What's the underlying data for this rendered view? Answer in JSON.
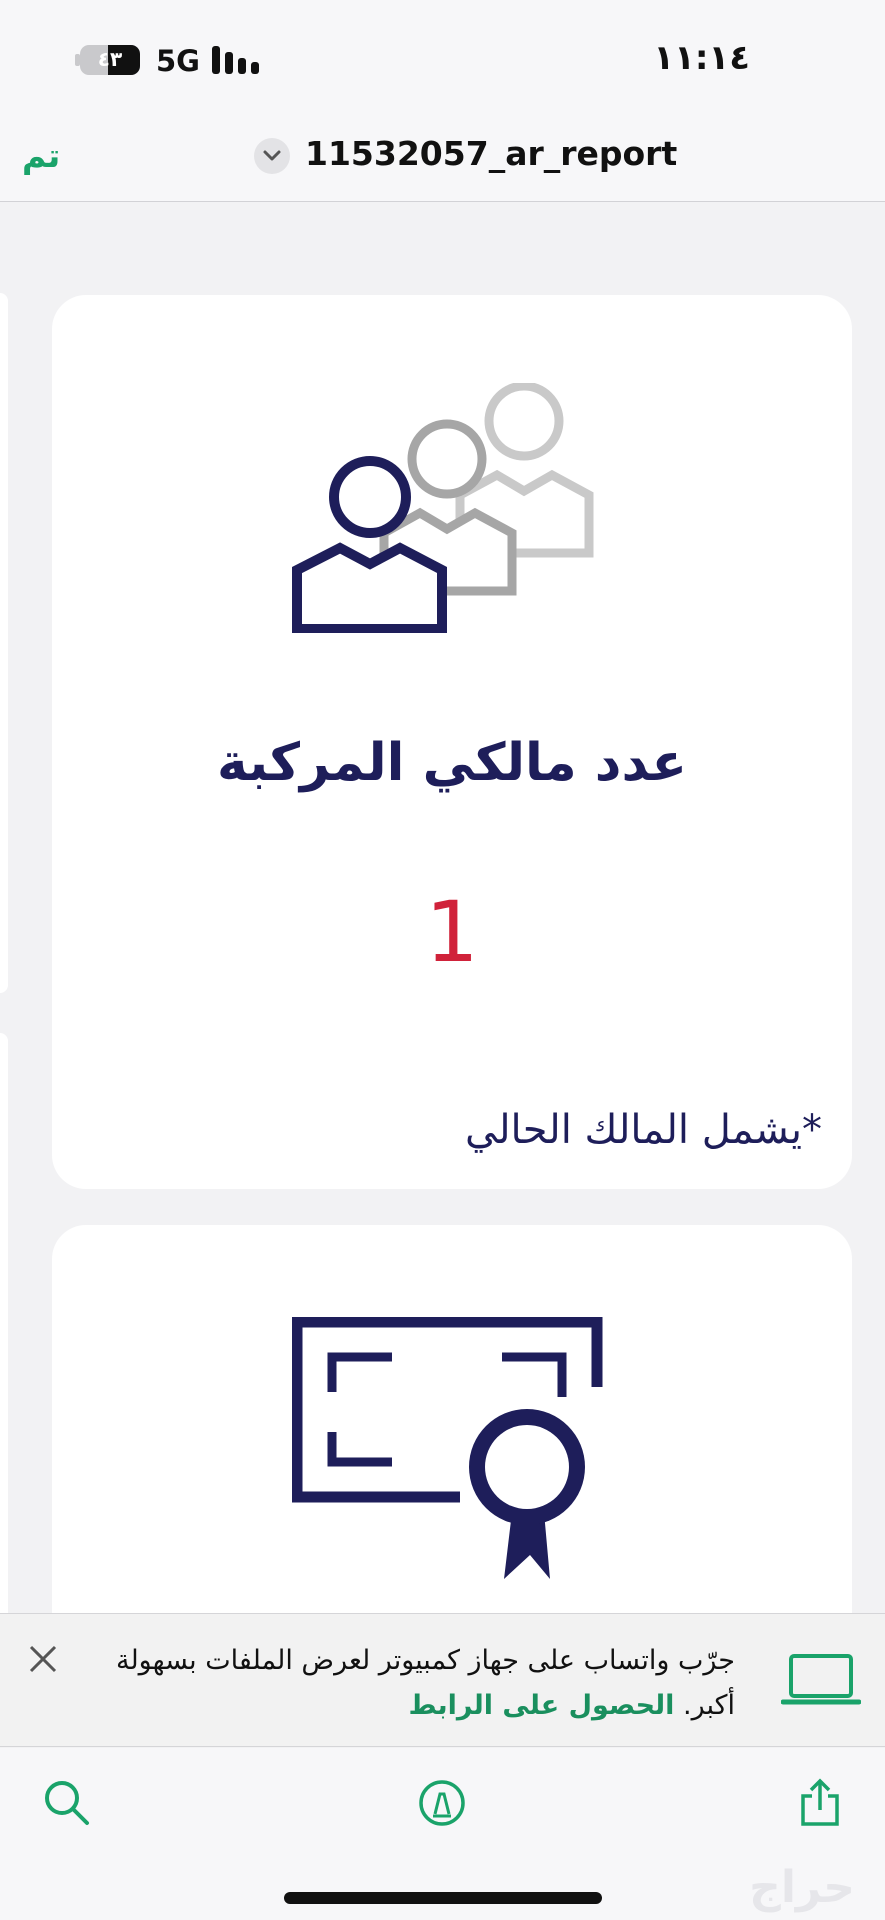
{
  "status_bar": {
    "time": "١١:١٤",
    "network": "5G",
    "battery": "٤٣"
  },
  "nav": {
    "done_label": "تم",
    "file_title": "11532057_ar_report"
  },
  "cards": {
    "owners": {
      "title": "عدد مالكي المركبة",
      "value": "1",
      "note": "*يشمل المالك الحالي"
    }
  },
  "banner": {
    "text": "جرّب واتساب على جهاز كمبيوتر لعرض الملفات بسهولة أكبر.",
    "link": "الحصول على الرابط"
  },
  "toolbar": {
    "search_icon": "search-icon",
    "markup_icon": "markup-pen-icon",
    "share_icon": "share-icon"
  },
  "watermark": "حراج",
  "colors": {
    "accent_green": "#1aa36a",
    "navy": "#1e1e5a",
    "red": "#d0223a"
  }
}
